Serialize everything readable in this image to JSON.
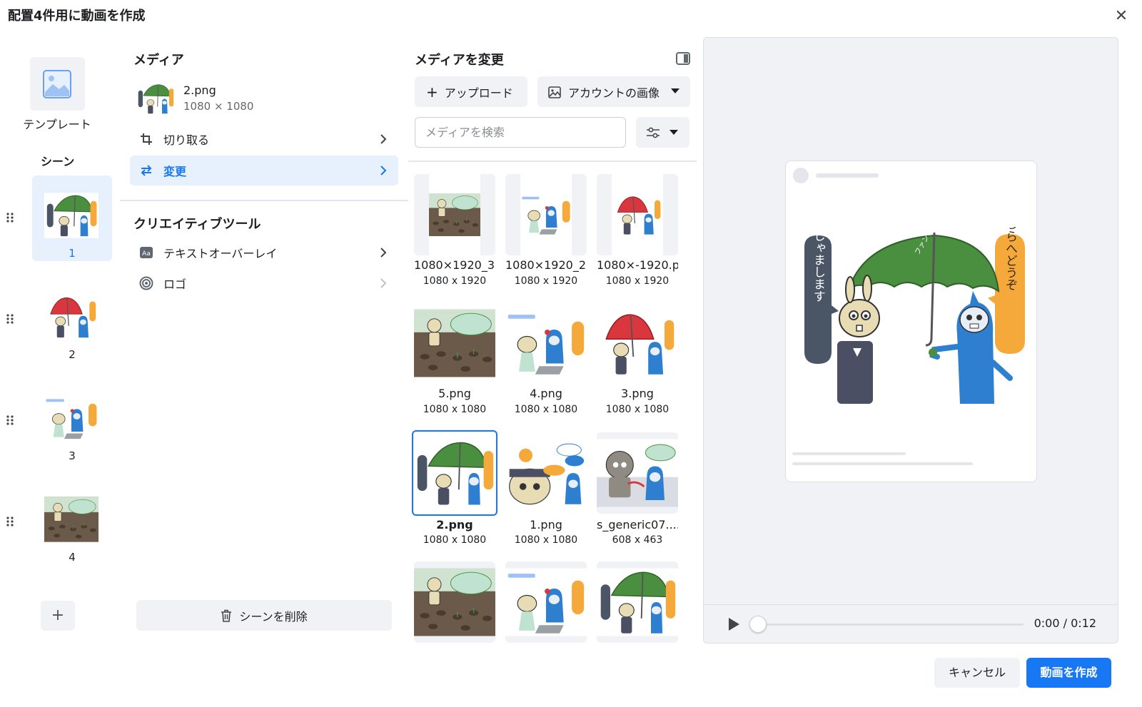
{
  "dialog": {
    "title": "配置4件用に動画を作成",
    "close_icon": "close-icon"
  },
  "scenes": {
    "template_label": "テンプレート",
    "heading": "シーン",
    "items": [
      {
        "num": "1",
        "art": "umbrella-green"
      },
      {
        "num": "2",
        "art": "umbrella-red"
      },
      {
        "num": "3",
        "art": "laptop"
      },
      {
        "num": "4",
        "art": "field"
      }
    ],
    "add_label": "+"
  },
  "settings": {
    "media_heading": "メディア",
    "file_name": "2.png",
    "file_dims": "1080 × 1080",
    "crop_label": "切り取る",
    "change_label": "変更",
    "creative_heading": "クリエイティブツール",
    "text_overlay_label": "テキストオーバーレイ",
    "logo_label": "ロゴ",
    "delete_label": "シーンを削除"
  },
  "media": {
    "heading": "メディアを変更",
    "upload_label": "アップロード",
    "account_images_label": "アカウントの画像",
    "search_placeholder": "メディアを検索",
    "tiles": [
      {
        "name": "1080×1920_3...",
        "dims": "1080 x 1920",
        "art": "field"
      },
      {
        "name": "1080×1920_2...",
        "dims": "1080 x 1920",
        "art": "laptop"
      },
      {
        "name": "1080×-1920.p...",
        "dims": "1080 x 1920",
        "art": "umbrella-red"
      },
      {
        "name": "5.png",
        "dims": "1080 x 1080",
        "art": "field"
      },
      {
        "name": "4.png",
        "dims": "1080 x 1080",
        "art": "laptop"
      },
      {
        "name": "3.png",
        "dims": "1080 x 1080",
        "art": "umbrella-red"
      },
      {
        "name": "2.png",
        "dims": "1080 x 1080",
        "art": "umbrella-green"
      },
      {
        "name": "1.png",
        "dims": "1080 x 1080",
        "art": "characters"
      },
      {
        "name": "s_generic07....",
        "dims": "608 x 463",
        "art": "sofa"
      },
      {
        "name": "",
        "dims": "",
        "art": "field"
      },
      {
        "name": "",
        "dims": "",
        "art": "laptop"
      },
      {
        "name": "",
        "dims": "",
        "art": "umbrella-green"
      }
    ]
  },
  "preview": {
    "bubble_left": "おじゃまします",
    "bubble_right": "こちらへどうぞ",
    "umbrella_text": "ファンプラムのアカウント",
    "time": "0:00 / 0:12",
    "progress": 0
  },
  "footer": {
    "cancel_label": "キャンセル",
    "create_label": "動画を作成"
  },
  "colors": {
    "accent": "#1877f2",
    "selected_bg": "#e7f0fd",
    "umbrella_green": "#4a8f3f",
    "umbrella_red": "#d9363e"
  }
}
